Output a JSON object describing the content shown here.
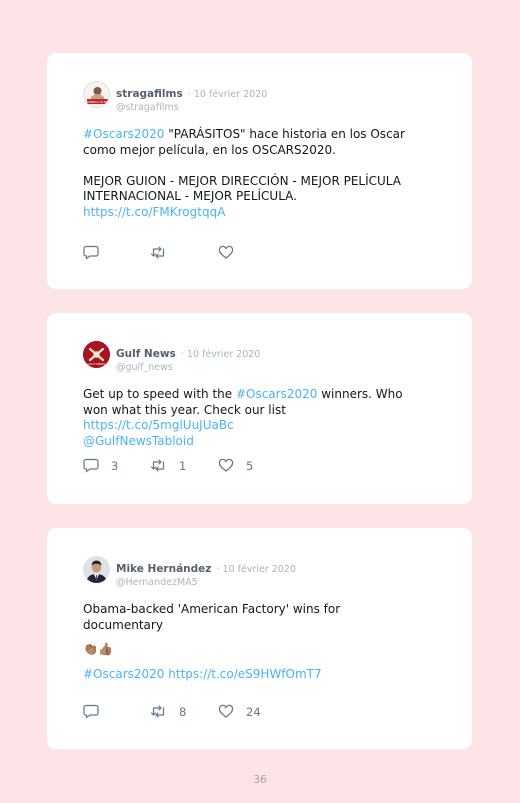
{
  "tweets": [
    {
      "name": "stragafilms",
      "date": "· 10 février 2020",
      "handle": "@stragafilms",
      "avatar": {
        "icon": "strega-films-logo",
        "text": "STREGA FILMS"
      },
      "hashtag": "#Oscars2020",
      "line1": " \"PARÁSITOS\" hace historia en los Oscar como mejor película, en los OSCARS2020.",
      "line2": "MEJOR GUION - MEJOR DIRECCIÓN - MEJOR PELÍCULA INTERNACIONAL - MEJOR PELÍCULA.",
      "link": "https://t.co/FMKrogtqqA",
      "counts": {
        "reply": "",
        "retweet": "",
        "like": ""
      }
    },
    {
      "name": "Gulf News",
      "date": "· 10 février 2020",
      "handle": "@gulf_news",
      "avatar": {
        "icon": "gulf-news-logo",
        "text": "GULF NEWS"
      },
      "text_before": "Get up to speed with the ",
      "hashtag": "#Oscars2020",
      "text_after": " winners. Who won what this year. Check our list ",
      "link": "https://t.co/5mglUuJUaBc",
      "mention": "@GulfNewsTabloid",
      "counts": {
        "reply": "3",
        "retweet": "1",
        "like": "5"
      }
    },
    {
      "name": "Mike Hernández",
      "date": "· 10 février 2020",
      "handle": "@HernandezMA5",
      "avatar": {
        "icon": "user-photo"
      },
      "text": "Obama-backed 'American Factory' wins for documentary",
      "emoji": "👏🏽👍🏽",
      "hashtag": "#Oscars2020",
      "link": "https://t.co/eS9HWfOmT7",
      "counts": {
        "reply": "",
        "retweet": "8",
        "like": "24"
      }
    }
  ],
  "page_number": "36",
  "colors": {
    "background": "#fde4e7",
    "link": "#4ab3f4",
    "icon": "#657786"
  }
}
